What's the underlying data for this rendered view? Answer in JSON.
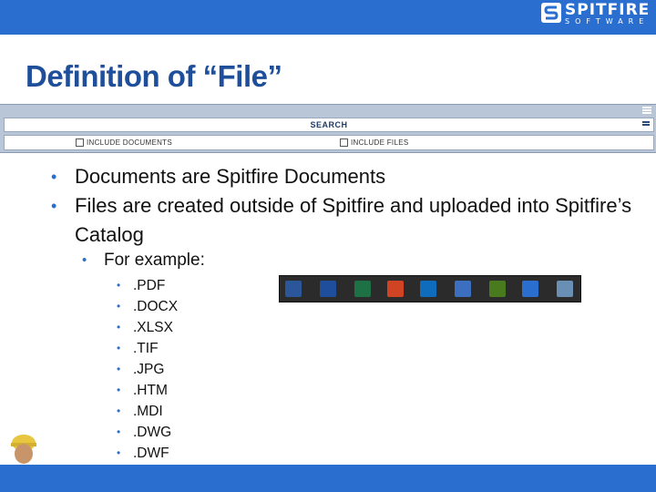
{
  "header": {
    "logo_word": "SPITFIRE",
    "logo_sub": "SOFTWARE",
    "logo_reg": "®",
    "brand_color": "#2a6fcf"
  },
  "slide": {
    "title": "Definition of “File”"
  },
  "search_panel": {
    "heading": "SEARCH",
    "include_documents": "INCLUDE DOCUMENTS",
    "include_files": "INCLUDE FILES"
  },
  "bullets": [
    "Documents are Spitfire Documents",
    "Files are created outside of Spitfire and uploaded into Spitfire’s Catalog"
  ],
  "example_label": "For example:",
  "extensions": [
    ".PDF",
    ".DOCX",
    ".XLSX",
    ".TIF",
    ".JPG",
    ".HTM",
    ".MDI",
    ".DWG",
    ".DWF"
  ],
  "app_icons": [
    {
      "name": "word-legacy-icon",
      "glyph": "W",
      "color": "#2b579a"
    },
    {
      "name": "word-icon",
      "glyph": "W",
      "color": "#1e4e9c"
    },
    {
      "name": "excel-icon",
      "glyph": "X",
      "color": "#1e7145"
    },
    {
      "name": "powerpoint-icon",
      "glyph": "P",
      "color": "#d04423"
    },
    {
      "name": "outlook-icon",
      "glyph": "O",
      "color": "#0f6cbd"
    },
    {
      "name": "remote-desktop-icon",
      "glyph": "▣",
      "color": "#3c6fc0"
    },
    {
      "name": "dreamweaver-icon",
      "glyph": "Dw",
      "color": "#4a7a1e"
    },
    {
      "name": "spitfire-app-icon",
      "glyph": "S",
      "color": "#2a6fcf"
    },
    {
      "name": "notepad-icon",
      "glyph": "✎",
      "color": "#6a8fb5"
    }
  ]
}
